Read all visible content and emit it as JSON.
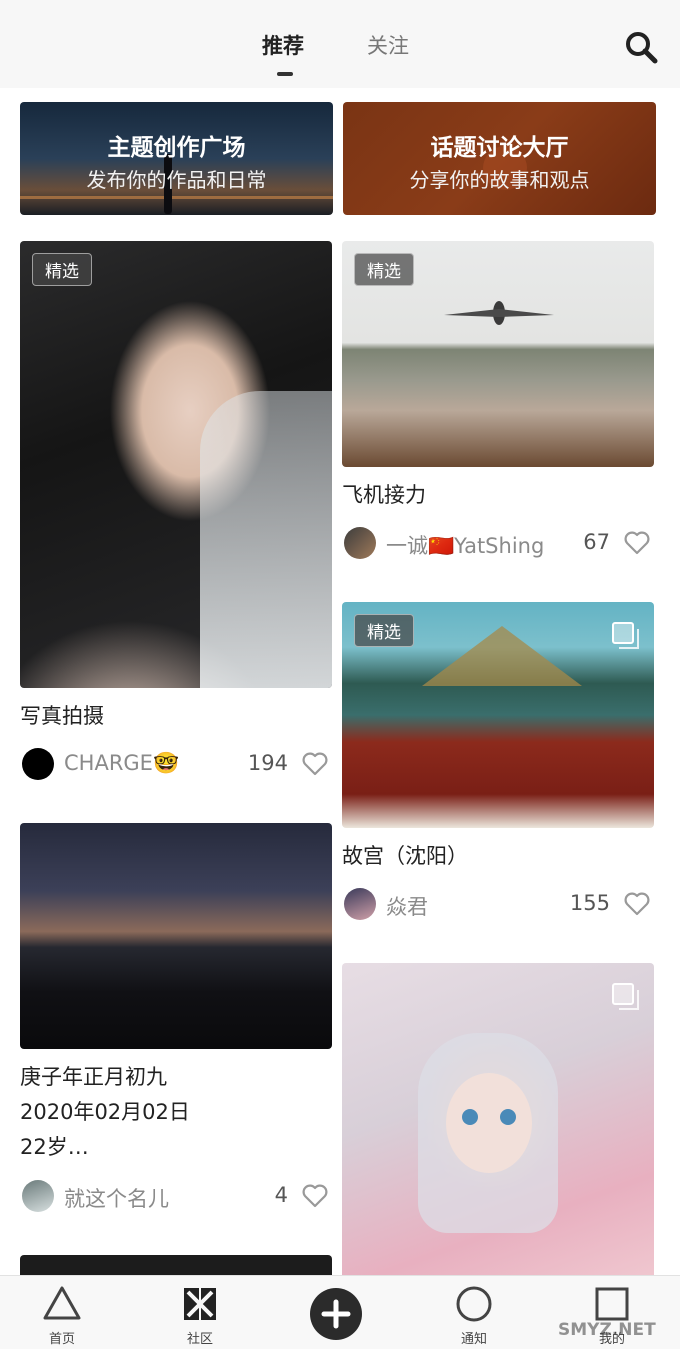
{
  "header": {
    "tabs": [
      {
        "label": "推荐",
        "active": true
      },
      {
        "label": "关注",
        "active": false
      }
    ],
    "search_icon": "search-icon"
  },
  "banners": [
    {
      "title": "主题创作广场",
      "subtitle": "发布你的作品和日常"
    },
    {
      "title": "话题讨论大厅",
      "subtitle": "分享你的故事和观点"
    }
  ],
  "cards": [
    {
      "badge": "精选",
      "title": "写真拍摄",
      "user": "CHARGE🤓",
      "likes": "194"
    },
    {
      "badge": "精选",
      "title": "飞机接力",
      "user": "一诚🇨🇳YatShing",
      "likes": "67"
    },
    {
      "badge": "精选",
      "title": "故宫（沈阳）",
      "user": "焱君",
      "likes": "155"
    },
    {
      "title_lines": [
        "庚子年正月初九",
        "2020年02月02日",
        "22岁…"
      ],
      "user": "就这个名儿",
      "likes": "4"
    }
  ],
  "nav": {
    "items": [
      {
        "label": "首页",
        "icon": "triangle-icon"
      },
      {
        "label": "社区",
        "icon": "community-icon"
      },
      {
        "label": "",
        "icon": "plus-icon"
      },
      {
        "label": "通知",
        "icon": "circle-icon"
      },
      {
        "label": "我的",
        "icon": "square-icon"
      }
    ]
  },
  "watermark": "SMYZ.NET",
  "colors": {
    "accent": "#2b2b2b",
    "banner2": "#7a3414"
  }
}
